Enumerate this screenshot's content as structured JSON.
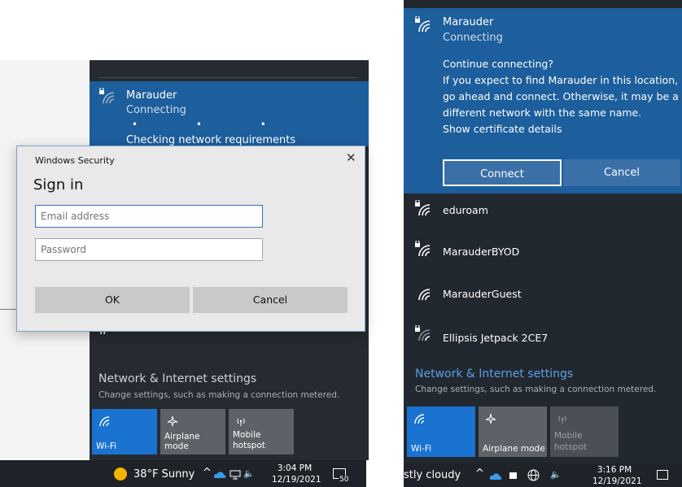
{
  "left": {
    "network": {
      "name": "Marauder",
      "status": "Connecting",
      "dots": "• • •",
      "progress": "Checking network requirements"
    },
    "dialog": {
      "window_title": "Windows Security",
      "close_glyph": "✕",
      "heading": "Sign in",
      "email_placeholder": "Email address",
      "password_placeholder": "Password",
      "ok_label": "OK",
      "cancel_label": "Cancel"
    },
    "settings": {
      "title": "Network & Internet settings",
      "subtitle": "Change settings, such as making a connection metered."
    },
    "tiles": [
      {
        "label": "Wi-Fi",
        "icon": "wifi-icon",
        "active": true
      },
      {
        "label": "Airplane mode",
        "icon": "airplane-icon",
        "active": false
      },
      {
        "label": "Mobile hotspot",
        "icon": "hotspot-icon",
        "active": false
      }
    ],
    "tile_hotspot_line1": "Mobile",
    "tile_hotspot_line2": "hotspot",
    "taskbar": {
      "weather": "38°F Sunny",
      "time": "3:04 PM",
      "date": "12/19/2021",
      "notification_count": "50"
    }
  },
  "right": {
    "network": {
      "name": "Marauder",
      "status": "Connecting"
    },
    "message": {
      "line1": "Continue connecting?",
      "line2": "If you expect to find Marauder in this location,",
      "line3": "go ahead and connect. Otherwise, it may be a",
      "line4": "different network with the same name.",
      "line5": "Show certificate details"
    },
    "connect_label": "Connect",
    "cancel_label": "Cancel",
    "networks": [
      {
        "name": "eduroam",
        "secured": true
      },
      {
        "name": "MarauderBYOD",
        "secured": true
      },
      {
        "name": "MarauderGuest",
        "secured": false
      },
      {
        "name": "Ellipsis Jetpack 2CE7",
        "secured": true
      }
    ],
    "settings": {
      "title": "Network & Internet settings",
      "subtitle": "Change settings, such as making a connection metered."
    },
    "tiles": [
      {
        "label": "Wi-Fi",
        "icon": "wifi-icon",
        "active": true
      },
      {
        "label": "Airplane mode",
        "icon": "airplane-icon",
        "active": false
      },
      {
        "label": "Mobile hotspot",
        "icon": "hotspot-icon",
        "active": false
      }
    ],
    "tile_hotspot_line1": "Mobile",
    "tile_hotspot_line2": "hotspot",
    "taskbar": {
      "weather": "stly cloudy",
      "time": "3:16 PM",
      "date": "12/19/2021"
    }
  },
  "colors": {
    "accent": "#1d5e9c",
    "panel": "#262b31",
    "tile_active": "#1a73d1",
    "tile_inactive": "#5d6168",
    "link": "#5aa0e6"
  }
}
